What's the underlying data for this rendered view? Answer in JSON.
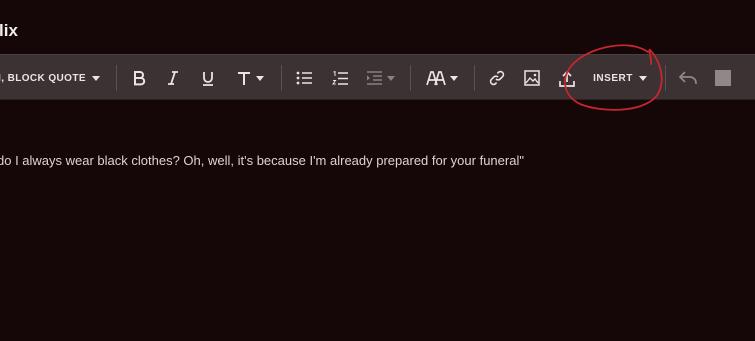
{
  "page": {
    "title": "lix"
  },
  "toolbar": {
    "style_select_label": "I, BLOCK QUOTE",
    "insert_label": "INSERT",
    "icons": [
      "bold-icon",
      "italic-icon",
      "underline-icon",
      "text-size-icon",
      "bulleted-list-icon",
      "numbered-list-icon",
      "indent-icon",
      "font-icon",
      "link-icon",
      "image-icon",
      "upload-icon",
      "undo-icon",
      "stop-square-icon"
    ]
  },
  "editor": {
    "text": "do I always wear black clothes? Oh, well, it's because I'm already prepared for your funeral\""
  },
  "colors": {
    "background": "#150708",
    "toolbar": "#3c3233",
    "annotation": "#c8262e"
  }
}
